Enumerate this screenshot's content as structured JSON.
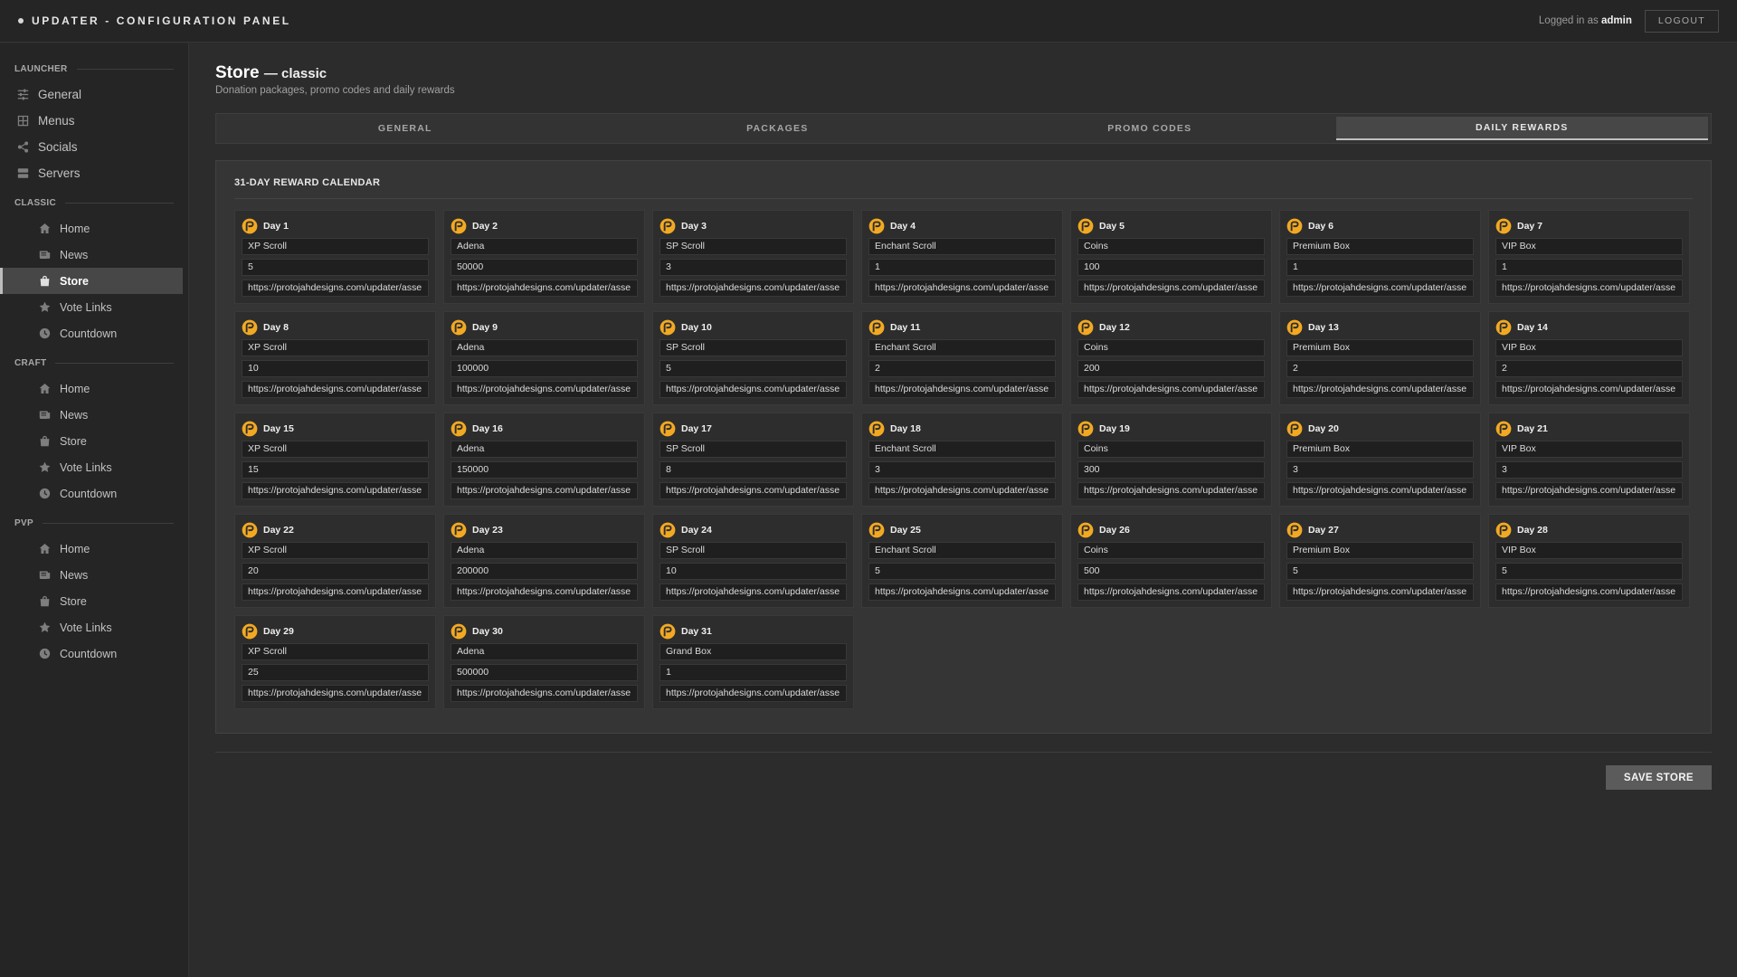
{
  "app": {
    "title": "UPDATER - CONFIGURATION PANEL"
  },
  "header": {
    "logged_in_prefix": "Logged in as",
    "username": "admin",
    "logout_label": "LOGOUT"
  },
  "sidebar": {
    "sections": [
      {
        "label": "LAUNCHER",
        "items": [
          {
            "label": "General",
            "icon": "sliders-icon"
          },
          {
            "label": "Menus",
            "icon": "grid-icon"
          },
          {
            "label": "Socials",
            "icon": "share-icon"
          },
          {
            "label": "Servers",
            "icon": "server-icon"
          }
        ]
      },
      {
        "label": "CLASSIC",
        "items": [
          {
            "label": "Home",
            "icon": "home-icon"
          },
          {
            "label": "News",
            "icon": "newspaper-icon"
          },
          {
            "label": "Store",
            "icon": "bag-icon",
            "active": true
          },
          {
            "label": "Vote Links",
            "icon": "star-icon"
          },
          {
            "label": "Countdown",
            "icon": "clock-icon"
          }
        ]
      },
      {
        "label": "CRAFT",
        "items": [
          {
            "label": "Home",
            "icon": "home-icon"
          },
          {
            "label": "News",
            "icon": "newspaper-icon"
          },
          {
            "label": "Store",
            "icon": "bag-icon"
          },
          {
            "label": "Vote Links",
            "icon": "star-icon"
          },
          {
            "label": "Countdown",
            "icon": "clock-icon"
          }
        ]
      },
      {
        "label": "PVP",
        "items": [
          {
            "label": "Home",
            "icon": "home-icon"
          },
          {
            "label": "News",
            "icon": "newspaper-icon"
          },
          {
            "label": "Store",
            "icon": "bag-icon"
          },
          {
            "label": "Vote Links",
            "icon": "star-icon"
          },
          {
            "label": "Countdown",
            "icon": "clock-icon"
          }
        ]
      }
    ]
  },
  "page": {
    "title": "Store",
    "title_suffix": "— classic",
    "subtitle": "Donation packages, promo codes and daily rewards"
  },
  "tabs": [
    {
      "label": "GENERAL"
    },
    {
      "label": "PACKAGES"
    },
    {
      "label": "PROMO CODES"
    },
    {
      "label": "DAILY REWARDS",
      "active": true
    }
  ],
  "rewards": {
    "title": "31-DAY REWARD CALENDAR",
    "icon_color": "#f2a922",
    "days": [
      {
        "label": "Day 1",
        "item": "XP Scroll",
        "amount": "5",
        "image_url": "https://protojahdesigns.com/updater/asse"
      },
      {
        "label": "Day 2",
        "item": "Adena",
        "amount": "50000",
        "image_url": "https://protojahdesigns.com/updater/asse"
      },
      {
        "label": "Day 3",
        "item": "SP Scroll",
        "amount": "3",
        "image_url": "https://protojahdesigns.com/updater/asse"
      },
      {
        "label": "Day 4",
        "item": "Enchant Scroll",
        "amount": "1",
        "image_url": "https://protojahdesigns.com/updater/asse"
      },
      {
        "label": "Day 5",
        "item": "Coins",
        "amount": "100",
        "image_url": "https://protojahdesigns.com/updater/asse"
      },
      {
        "label": "Day 6",
        "item": "Premium Box",
        "amount": "1",
        "image_url": "https://protojahdesigns.com/updater/asse"
      },
      {
        "label": "Day 7",
        "item": "VIP Box",
        "amount": "1",
        "image_url": "https://protojahdesigns.com/updater/asse"
      },
      {
        "label": "Day 8",
        "item": "XP Scroll",
        "amount": "10",
        "image_url": "https://protojahdesigns.com/updater/asse"
      },
      {
        "label": "Day 9",
        "item": "Adena",
        "amount": "100000",
        "image_url": "https://protojahdesigns.com/updater/asse"
      },
      {
        "label": "Day 10",
        "item": "SP Scroll",
        "amount": "5",
        "image_url": "https://protojahdesigns.com/updater/asse"
      },
      {
        "label": "Day 11",
        "item": "Enchant Scroll",
        "amount": "2",
        "image_url": "https://protojahdesigns.com/updater/asse"
      },
      {
        "label": "Day 12",
        "item": "Coins",
        "amount": "200",
        "image_url": "https://protojahdesigns.com/updater/asse"
      },
      {
        "label": "Day 13",
        "item": "Premium Box",
        "amount": "2",
        "image_url": "https://protojahdesigns.com/updater/asse"
      },
      {
        "label": "Day 14",
        "item": "VIP Box",
        "amount": "2",
        "image_url": "https://protojahdesigns.com/updater/asse"
      },
      {
        "label": "Day 15",
        "item": "XP Scroll",
        "amount": "15",
        "image_url": "https://protojahdesigns.com/updater/asse"
      },
      {
        "label": "Day 16",
        "item": "Adena",
        "amount": "150000",
        "image_url": "https://protojahdesigns.com/updater/asse"
      },
      {
        "label": "Day 17",
        "item": "SP Scroll",
        "amount": "8",
        "image_url": "https://protojahdesigns.com/updater/asse"
      },
      {
        "label": "Day 18",
        "item": "Enchant Scroll",
        "amount": "3",
        "image_url": "https://protojahdesigns.com/updater/asse"
      },
      {
        "label": "Day 19",
        "item": "Coins",
        "amount": "300",
        "image_url": "https://protojahdesigns.com/updater/asse"
      },
      {
        "label": "Day 20",
        "item": "Premium Box",
        "amount": "3",
        "image_url": "https://protojahdesigns.com/updater/asse"
      },
      {
        "label": "Day 21",
        "item": "VIP Box",
        "amount": "3",
        "image_url": "https://protojahdesigns.com/updater/asse"
      },
      {
        "label": "Day 22",
        "item": "XP Scroll",
        "amount": "20",
        "image_url": "https://protojahdesigns.com/updater/asse"
      },
      {
        "label": "Day 23",
        "item": "Adena",
        "amount": "200000",
        "image_url": "https://protojahdesigns.com/updater/asse"
      },
      {
        "label": "Day 24",
        "item": "SP Scroll",
        "amount": "10",
        "image_url": "https://protojahdesigns.com/updater/asse"
      },
      {
        "label": "Day 25",
        "item": "Enchant Scroll",
        "amount": "5",
        "image_url": "https://protojahdesigns.com/updater/asse"
      },
      {
        "label": "Day 26",
        "item": "Coins",
        "amount": "500",
        "image_url": "https://protojahdesigns.com/updater/asse"
      },
      {
        "label": "Day 27",
        "item": "Premium Box",
        "amount": "5",
        "image_url": "https://protojahdesigns.com/updater/asse"
      },
      {
        "label": "Day 28",
        "item": "VIP Box",
        "amount": "5",
        "image_url": "https://protojahdesigns.com/updater/asse"
      },
      {
        "label": "Day 29",
        "item": "XP Scroll",
        "amount": "25",
        "image_url": "https://protojahdesigns.com/updater/asse"
      },
      {
        "label": "Day 30",
        "item": "Adena",
        "amount": "500000",
        "image_url": "https://protojahdesigns.com/updater/asse"
      },
      {
        "label": "Day 31",
        "item": "Grand Box",
        "amount": "1",
        "image_url": "https://protojahdesigns.com/updater/asse"
      }
    ]
  },
  "actions": {
    "save_label": "SAVE STORE"
  }
}
